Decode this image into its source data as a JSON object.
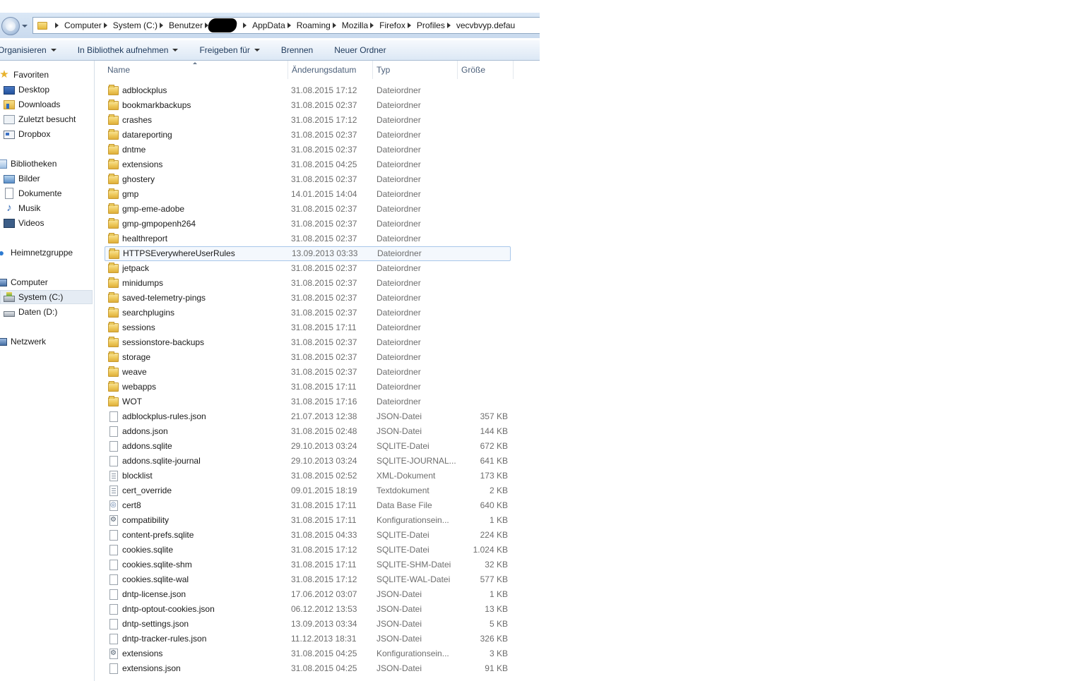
{
  "address_bar": {
    "crumbs": [
      "Computer",
      "System (C:)",
      "Benutzer",
      "AppData",
      "Roaming",
      "Mozilla",
      "Firefox",
      "Profiles",
      "vecvbvyp.defau"
    ]
  },
  "command_bar": {
    "organize": "Organisieren",
    "include_library": "In Bibliothek aufnehmen",
    "share_with": "Freigeben für",
    "burn": "Brennen",
    "new_folder": "Neuer Ordner"
  },
  "nav": {
    "favorites": "Favoriten",
    "desktop": "Desktop",
    "downloads": "Downloads",
    "recent": "Zuletzt besucht",
    "dropbox": "Dropbox",
    "libraries": "Bibliotheken",
    "pictures": "Bilder",
    "documents": "Dokumente",
    "music": "Musik",
    "videos": "Videos",
    "homegroup": "Heimnetzgruppe",
    "computer": "Computer",
    "drive_c": "System (C:)",
    "drive_d": "Daten (D:)",
    "network": "Netzwerk"
  },
  "columns": {
    "name": "Name",
    "modified": "Änderungsdatum",
    "type": "Typ",
    "size": "Größe"
  },
  "files": [
    {
      "name": "adblockplus",
      "date": "31.08.2015 17:12",
      "type": "Dateiordner",
      "size": "",
      "icon": "folder"
    },
    {
      "name": "bookmarkbackups",
      "date": "31.08.2015 02:37",
      "type": "Dateiordner",
      "size": "",
      "icon": "folder"
    },
    {
      "name": "crashes",
      "date": "31.08.2015 17:12",
      "type": "Dateiordner",
      "size": "",
      "icon": "folder"
    },
    {
      "name": "datareporting",
      "date": "31.08.2015 02:37",
      "type": "Dateiordner",
      "size": "",
      "icon": "folder"
    },
    {
      "name": "dntme",
      "date": "31.08.2015 02:37",
      "type": "Dateiordner",
      "size": "",
      "icon": "folder"
    },
    {
      "name": "extensions",
      "date": "31.08.2015 04:25",
      "type": "Dateiordner",
      "size": "",
      "icon": "folder"
    },
    {
      "name": "ghostery",
      "date": "31.08.2015 02:37",
      "type": "Dateiordner",
      "size": "",
      "icon": "folder"
    },
    {
      "name": "gmp",
      "date": "14.01.2015 14:04",
      "type": "Dateiordner",
      "size": "",
      "icon": "folder"
    },
    {
      "name": "gmp-eme-adobe",
      "date": "31.08.2015 02:37",
      "type": "Dateiordner",
      "size": "",
      "icon": "folder"
    },
    {
      "name": "gmp-gmpopenh264",
      "date": "31.08.2015 02:37",
      "type": "Dateiordner",
      "size": "",
      "icon": "folder"
    },
    {
      "name": "healthreport",
      "date": "31.08.2015 02:37",
      "type": "Dateiordner",
      "size": "",
      "icon": "folder"
    },
    {
      "name": "HTTPSEverywhereUserRules",
      "date": "13.09.2013 03:33",
      "type": "Dateiordner",
      "size": "",
      "icon": "folder",
      "highlight": true
    },
    {
      "name": "jetpack",
      "date": "31.08.2015 02:37",
      "type": "Dateiordner",
      "size": "",
      "icon": "folder"
    },
    {
      "name": "minidumps",
      "date": "31.08.2015 02:37",
      "type": "Dateiordner",
      "size": "",
      "icon": "folder"
    },
    {
      "name": "saved-telemetry-pings",
      "date": "31.08.2015 02:37",
      "type": "Dateiordner",
      "size": "",
      "icon": "folder"
    },
    {
      "name": "searchplugins",
      "date": "31.08.2015 02:37",
      "type": "Dateiordner",
      "size": "",
      "icon": "folder"
    },
    {
      "name": "sessions",
      "date": "31.08.2015 17:11",
      "type": "Dateiordner",
      "size": "",
      "icon": "folder"
    },
    {
      "name": "sessionstore-backups",
      "date": "31.08.2015 02:37",
      "type": "Dateiordner",
      "size": "",
      "icon": "folder"
    },
    {
      "name": "storage",
      "date": "31.08.2015 02:37",
      "type": "Dateiordner",
      "size": "",
      "icon": "folder"
    },
    {
      "name": "weave",
      "date": "31.08.2015 02:37",
      "type": "Dateiordner",
      "size": "",
      "icon": "folder"
    },
    {
      "name": "webapps",
      "date": "31.08.2015 17:11",
      "type": "Dateiordner",
      "size": "",
      "icon": "folder"
    },
    {
      "name": "WOT",
      "date": "31.08.2015 17:16",
      "type": "Dateiordner",
      "size": "",
      "icon": "folder"
    },
    {
      "name": "adblockplus-rules.json",
      "date": "21.07.2013 12:38",
      "type": "JSON-Datei",
      "size": "357 KB",
      "icon": "file"
    },
    {
      "name": "addons.json",
      "date": "31.08.2015 02:48",
      "type": "JSON-Datei",
      "size": "144 KB",
      "icon": "file"
    },
    {
      "name": "addons.sqlite",
      "date": "29.10.2013 03:24",
      "type": "SQLITE-Datei",
      "size": "672 KB",
      "icon": "file"
    },
    {
      "name": "addons.sqlite-journal",
      "date": "29.10.2013 03:24",
      "type": "SQLITE-JOURNAL...",
      "size": "641 KB",
      "icon": "file"
    },
    {
      "name": "blocklist",
      "date": "31.08.2015 02:52",
      "type": "XML-Dokument",
      "size": "173 KB",
      "icon": "xml"
    },
    {
      "name": "cert_override",
      "date": "09.01.2015 18:19",
      "type": "Textdokument",
      "size": "2 KB",
      "icon": "text"
    },
    {
      "name": "cert8",
      "date": "31.08.2015 17:11",
      "type": "Data Base File",
      "size": "640 KB",
      "icon": "cert"
    },
    {
      "name": "compatibility",
      "date": "31.08.2015 17:11",
      "type": "Konfigurationsein...",
      "size": "1 KB",
      "icon": "config"
    },
    {
      "name": "content-prefs.sqlite",
      "date": "31.08.2015 04:33",
      "type": "SQLITE-Datei",
      "size": "224 KB",
      "icon": "file"
    },
    {
      "name": "cookies.sqlite",
      "date": "31.08.2015 17:12",
      "type": "SQLITE-Datei",
      "size": "1.024 KB",
      "icon": "file"
    },
    {
      "name": "cookies.sqlite-shm",
      "date": "31.08.2015 17:11",
      "type": "SQLITE-SHM-Datei",
      "size": "32 KB",
      "icon": "file"
    },
    {
      "name": "cookies.sqlite-wal",
      "date": "31.08.2015 17:12",
      "type": "SQLITE-WAL-Datei",
      "size": "577 KB",
      "icon": "file"
    },
    {
      "name": "dntp-license.json",
      "date": "17.06.2012 03:07",
      "type": "JSON-Datei",
      "size": "1 KB",
      "icon": "file"
    },
    {
      "name": "dntp-optout-cookies.json",
      "date": "06.12.2012 13:53",
      "type": "JSON-Datei",
      "size": "13 KB",
      "icon": "file"
    },
    {
      "name": "dntp-settings.json",
      "date": "13.09.2013 03:34",
      "type": "JSON-Datei",
      "size": "5 KB",
      "icon": "file"
    },
    {
      "name": "dntp-tracker-rules.json",
      "date": "11.12.2013 18:31",
      "type": "JSON-Datei",
      "size": "326 KB",
      "icon": "file"
    },
    {
      "name": "extensions",
      "date": "31.08.2015 04:25",
      "type": "Konfigurationsein...",
      "size": "3 KB",
      "icon": "config"
    },
    {
      "name": "extensions.json",
      "date": "31.08.2015 04:25",
      "type": "JSON-Datei",
      "size": "91 KB",
      "icon": "file"
    }
  ]
}
